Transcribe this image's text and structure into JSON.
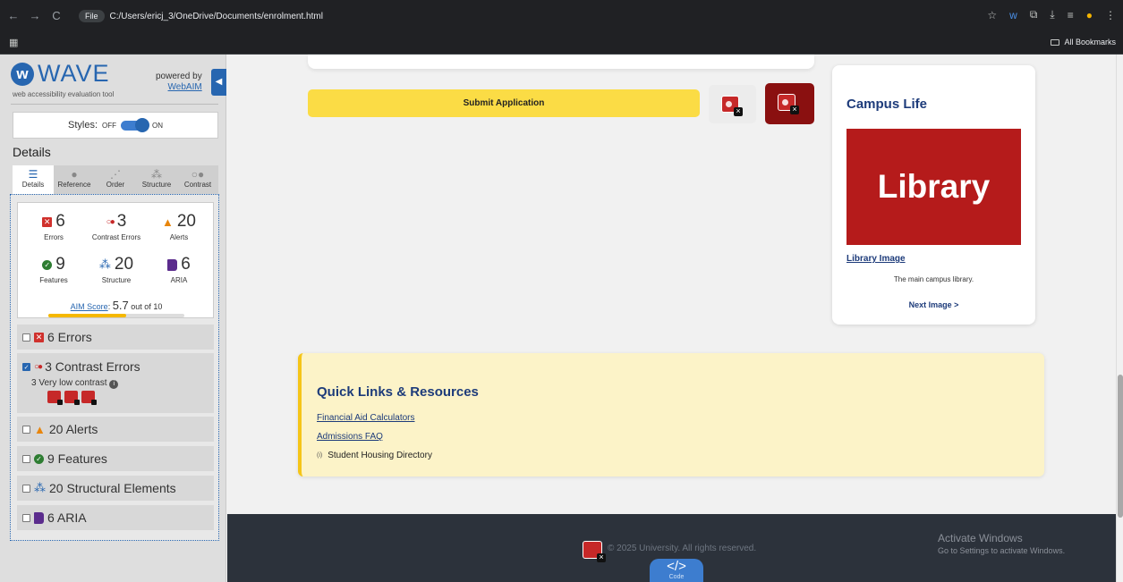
{
  "browser": {
    "nav": {
      "back": "←",
      "forward": "→",
      "reload": "C"
    },
    "file_chip": "File",
    "url": "C:/Users/ericj_3/OneDrive/Documents/enrolment.html",
    "bookmarks_label": "All Bookmarks"
  },
  "wave": {
    "title": "WAVE",
    "subtitle": "web accessibility evaluation tool",
    "powered_by": "powered by",
    "webaim": "WebAIM",
    "styles_label": "Styles:",
    "styles_off": "OFF",
    "styles_on": "ON",
    "details_heading": "Details",
    "tabs": [
      {
        "label": "Details",
        "icon": "list-icon"
      },
      {
        "label": "Reference",
        "icon": "info-icon"
      },
      {
        "label": "Order",
        "icon": "order-icon"
      },
      {
        "label": "Structure",
        "icon": "structure-icon"
      },
      {
        "label": "Contrast",
        "icon": "contrast-icon"
      }
    ],
    "summary": {
      "errors": {
        "count": "6",
        "label": "Errors"
      },
      "contrast": {
        "count": "3",
        "label": "Contrast Errors"
      },
      "alerts": {
        "count": "20",
        "label": "Alerts"
      },
      "features": {
        "count": "9",
        "label": "Features"
      },
      "structure": {
        "count": "20",
        "label": "Structure"
      },
      "aria": {
        "count": "6",
        "label": "ARIA"
      }
    },
    "aim": {
      "label": "AIM Score",
      "score": "5.7",
      "suffix": "out of 10",
      "fraction": 0.57
    },
    "categories": {
      "errors": "6 Errors",
      "contrast": "3 Contrast Errors",
      "contrast_detail": "3 Very low contrast",
      "alerts": "20 Alerts",
      "features": "9 Features",
      "structure": "20 Structural Elements",
      "aria": "6 ARIA"
    }
  },
  "page": {
    "submit_label": "Submit Application",
    "campus": {
      "title": "Campus Life",
      "image_text": "Library",
      "image_link": "Library Image",
      "caption": "The main campus library.",
      "next": "Next Image >"
    },
    "quick_links": {
      "title": "Quick Links & Resources",
      "links": [
        "Financial Aid Calculators",
        "Admissions FAQ"
      ],
      "text_item": "Student Housing Directory",
      "text_icon": "(i)"
    },
    "footer": {
      "copyright": "© 2025 University. All rights reserved.",
      "code_tab": "</>",
      "code_label": "Code"
    },
    "activate": {
      "line1": "Activate Windows",
      "line2": "Go to Settings to activate Windows."
    }
  }
}
